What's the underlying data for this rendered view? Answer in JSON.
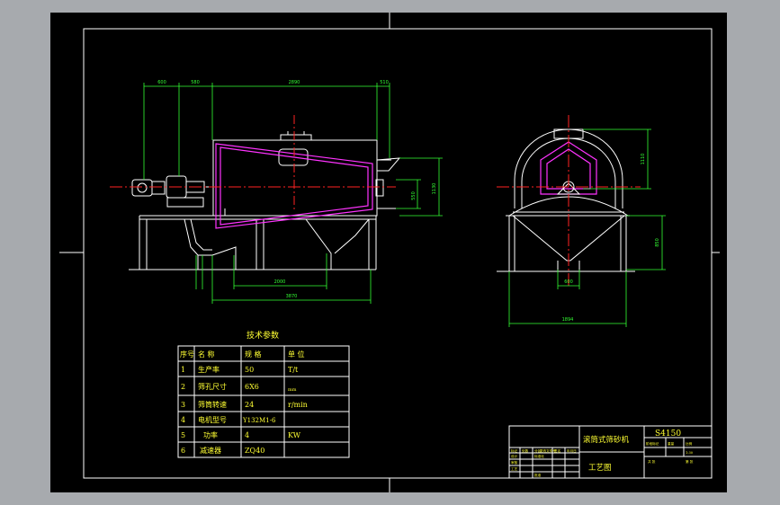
{
  "colors": {
    "viewport": "#a7aaae",
    "paper": "#000000",
    "line": "#ffffff",
    "dimension": "#33ff33",
    "center": "#ff2222",
    "highlight": "#ff33ff",
    "text": "#ffff33"
  },
  "dims_front": {
    "d1": "600",
    "d2": "580",
    "d3": "2890",
    "d4": "510",
    "d5": "2000",
    "d6": "3870",
    "d7": "1130",
    "d8": "550"
  },
  "dims_side": {
    "h1": "1110",
    "h2": "850",
    "w1": "600",
    "w2": "1894"
  },
  "spec_table": {
    "title": "技术参数",
    "headers": [
      "序号",
      "名  称",
      "规  格",
      "单  位"
    ],
    "rows": [
      [
        "1",
        "生产率",
        "50",
        "T/t"
      ],
      [
        "2",
        "筛孔尺寸",
        "6X6",
        "mm"
      ],
      [
        "3",
        "筛筒转速",
        "24",
        "r/min"
      ],
      [
        "4",
        "电机型号",
        "Y132M1-6",
        ""
      ],
      [
        "5",
        "功率",
        "4",
        "KW"
      ],
      [
        "6",
        "减速器",
        "ZQ40",
        ""
      ]
    ]
  },
  "title_block": {
    "drawing_name": "滚筒式筛砂机",
    "code": "S4150",
    "category": "工艺图",
    "left_cells": [
      "标记",
      "处数",
      "分区",
      "更改文件号",
      "签名",
      "年月日",
      "设计",
      "标准化",
      "审核",
      "工艺",
      "批准"
    ],
    "right_cells": [
      "阶段标记",
      "重量",
      "比例",
      "1:30",
      "共  张",
      "第  张"
    ]
  }
}
